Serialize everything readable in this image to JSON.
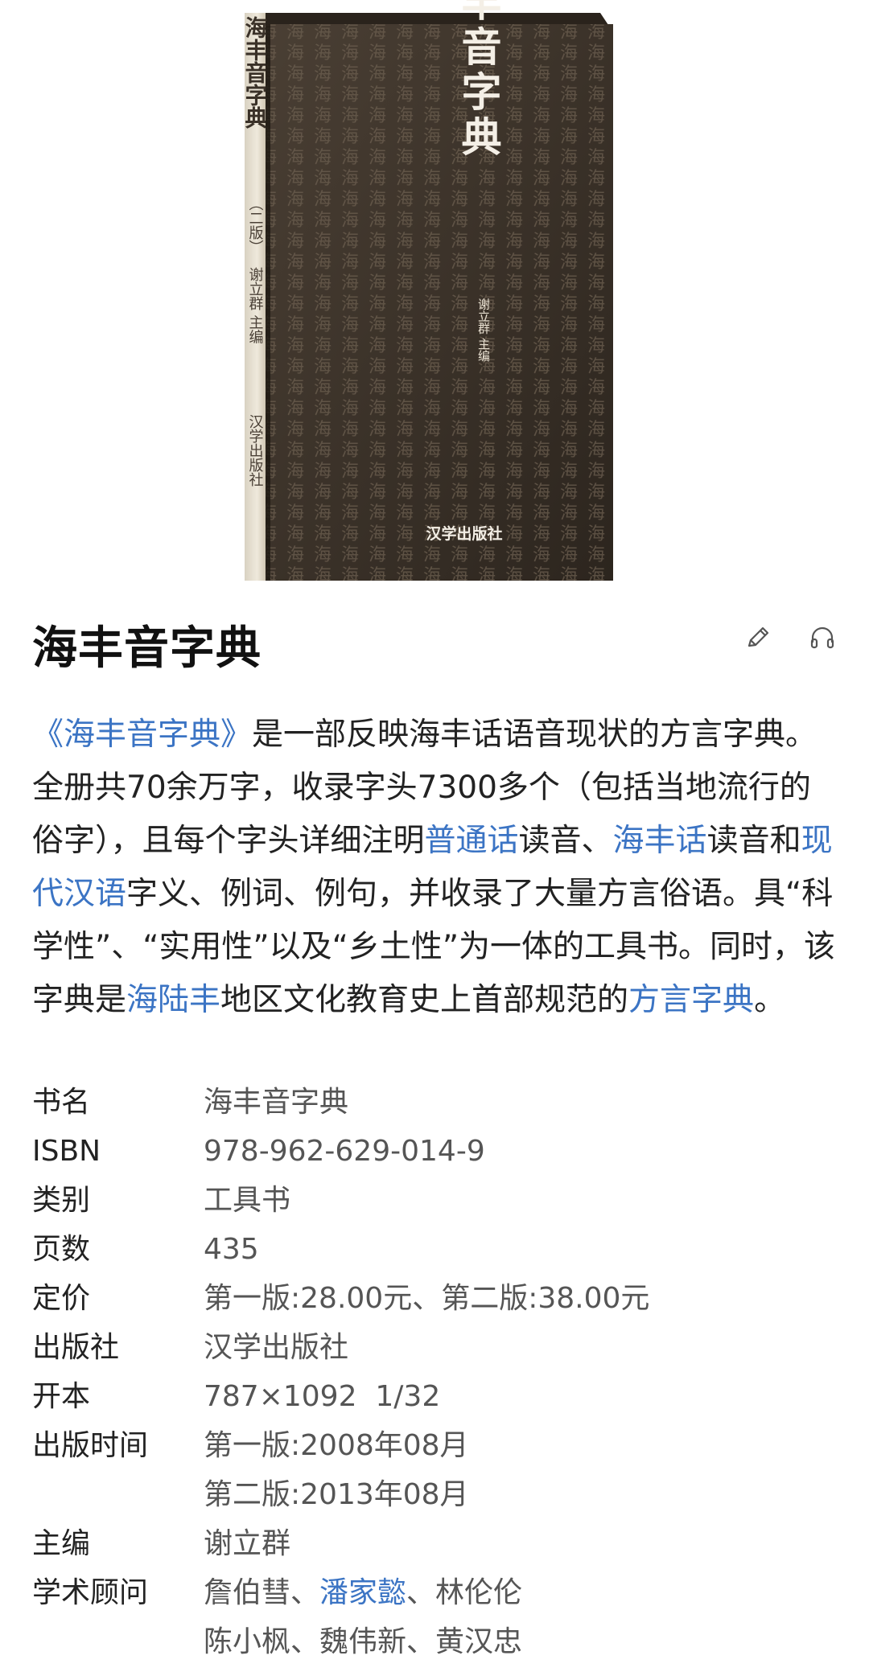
{
  "cover": {
    "spine_title": "海丰音字典",
    "spine_edition": "（二版）",
    "spine_editor": "谢立群 主编",
    "spine_publisher": "汉学出版社",
    "front_title": "海丰音字典",
    "front_editor": "谢立群 主编",
    "front_publisher": "汉学出版社",
    "pattern_text": "海丰音字典",
    "colors": {
      "cover_bg": "#3a3128",
      "pattern": "#6b5e4f",
      "title": "#f4efe6",
      "spine_bg": "#e9e3d6",
      "spine_text": "#4a4036"
    }
  },
  "header": {
    "title": "海丰音字典",
    "edit_icon": "pencil-icon",
    "listen_icon": "headphones-icon"
  },
  "summary": {
    "link_book": "《海丰音字典》",
    "t1": "是一部反映海丰话语音现状的方言字典。全册共70余万字，收录字头7300多个（包括当地流行的俗字），且每个字头详细注明",
    "link_putonghua": "普通话",
    "t2": "读音、",
    "link_haifenghua": "海丰话",
    "t3": "读音和",
    "link_modern": "现代汉语",
    "t4": "字义、例词、例句，并收录了大量方言俗语。具“科学性”、“实用性”以及“乡土性”为一体的工具书。同时，该字典是",
    "link_hailufeng": "海陆丰",
    "t5": "地区文化教育史上首部规范的",
    "link_dialect_dict": "方言字典",
    "t6": "。"
  },
  "info": {
    "book_name": {
      "label": "书名",
      "value": "海丰音字典"
    },
    "isbn": {
      "label": "ISBN",
      "value": "978-962-629-014-9"
    },
    "category": {
      "label": "类别",
      "value": "工具书"
    },
    "pages": {
      "label": "页数",
      "value": "435"
    },
    "price": {
      "label": "定价",
      "value": "第一版:28.00元、第二版:38.00元"
    },
    "publisher": {
      "label": "出版社",
      "value": "汉学出版社"
    },
    "format": {
      "label": "开本",
      "value": "787×1092  1/32"
    },
    "pub_time": {
      "label": "出版时间",
      "line1": "第一版:2008年08月",
      "line2": "第二版:2013年08月"
    },
    "editor": {
      "label": "主编",
      "value": "谢立群"
    },
    "advisors": {
      "label": "学术顾问",
      "a1": "詹伯彗、",
      "a2_link": "潘家懿",
      "a3": "、林伦伦",
      "line2": "陈小枫、魏伟新、黄汉忠"
    }
  },
  "colors": {
    "link": "#3b74c4",
    "text": "#222222",
    "value_text": "#555555"
  }
}
